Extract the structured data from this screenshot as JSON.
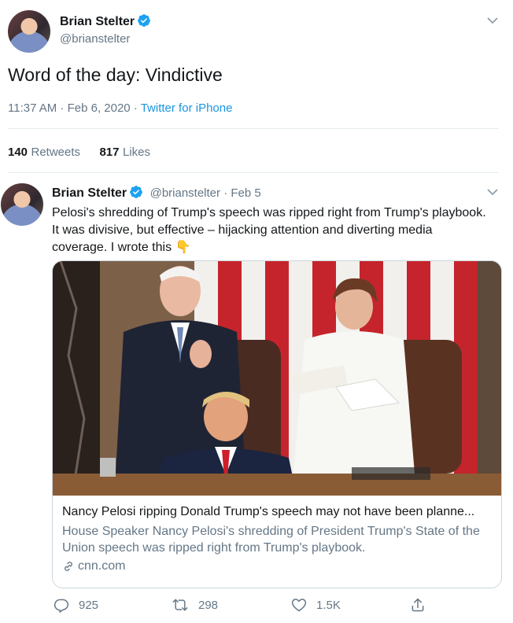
{
  "tweet": {
    "author_name": "Brian Stelter",
    "author_handle": "@brianstelter",
    "text": "Word of the day: Vindictive",
    "time": "11:37 AM · Feb 6, 2020 · ",
    "source": "Twitter for iPhone",
    "retweets_count": "140",
    "retweets_label": "Retweets",
    "likes_count": "817",
    "likes_label": "Likes"
  },
  "reply": {
    "author_name": "Brian Stelter",
    "author_handle": "@brianstelter",
    "date": " · Feb 5",
    "text": "Pelosi's shredding of Trump's speech was ripped right from Trump's playbook. It was divisive, but effective – hijacking attention and diverting media coverage. I wrote this",
    "emoji": "👇",
    "card": {
      "title": "Nancy Pelosi ripping Donald Trump's speech may not have been planne...",
      "description": "House Speaker Nancy Pelosi's shredding of President Trump's State of the Union speech was ripped right from Trump's playbook.",
      "domain": "cnn.com"
    },
    "actions": {
      "replies": "925",
      "retweets": "298",
      "likes": "1.5K"
    }
  },
  "colors": {
    "link": "#1b95e0",
    "secondary_text": "#657786",
    "verified": "#1da1f2"
  }
}
